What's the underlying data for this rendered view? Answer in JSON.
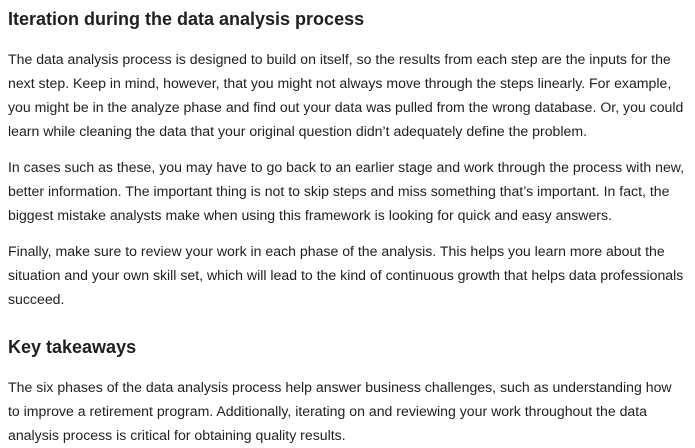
{
  "section1": {
    "heading": "Iteration during the data analysis process",
    "paragraphs": [
      "The data analysis process is designed to build on itself, so the results from each step are the inputs for the next step. Keep in mind, however, that you might not always move through the steps linearly. For example, you might be in the analyze phase and find out your data was pulled from the wrong database. Or, you could learn while cleaning the data that your original question didn’t adequately define the problem.",
      "In cases such as these, you may have to go back to an earlier stage and work through the process with new, better information. The important thing is not to skip steps and miss something that’s important. In fact, the biggest mistake analysts make when using this framework is looking for quick and easy answers.",
      "Finally, make sure to review your work in each phase of the analysis. This helps you learn more about the situation and your own skill set, which will lead to the kind of continuous growth that helps data professionals succeed."
    ]
  },
  "section2": {
    "heading": "Key takeaways",
    "paragraphs": [
      "The six phases of the data analysis process help answer business challenges, such as understanding how to improve a retirement program. Additionally, iterating on and reviewing your work throughout the data analysis process is critical for obtaining quality results."
    ]
  }
}
